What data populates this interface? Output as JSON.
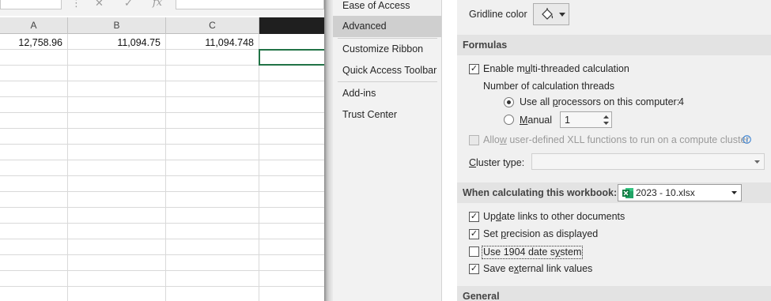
{
  "sheet": {
    "columns": [
      "A",
      "B",
      "C",
      ""
    ],
    "row1_values": [
      "12,758.96",
      "11,094.75",
      "11,094.748",
      ""
    ],
    "formula_icons": [
      "cancel-icon",
      "confirm-icon",
      "insert-function-icon"
    ],
    "formula_glyphs": {
      "more": "⋮",
      "cancel": "✕",
      "confirm": "✓",
      "fx": "fx"
    }
  },
  "nav": {
    "items": [
      "Ease of Access",
      "Advanced",
      "Customize Ribbon",
      "Quick Access Toolbar",
      "Add-ins",
      "Trust Center"
    ],
    "selected": "Advanced"
  },
  "options": {
    "gridline_color_label": "Gridline color",
    "formulas_header": "Formulas",
    "multithread_label": "Enable multi-threaded calculation",
    "multithread_checked": true,
    "threads_label": "Number of calculation threads",
    "all_processors_label": "Use all processors on this computer:",
    "processor_count": "4",
    "manual_label": "Manual",
    "manual_threads_value": "1",
    "xll_label": "Allow user-defined XLL functions to run on a compute cluster",
    "cluster_type_label": "Cluster type:",
    "cluster_type_value": "",
    "workbook_header": "When calculating this workbook:",
    "workbook_name": "2023 - 10.xlsx",
    "update_links_label": "Update links to other documents",
    "update_links_checked": true,
    "precision_label": "Set precision as displayed",
    "precision_checked": true,
    "date1904_label": "Use 1904 date system",
    "date1904_checked": false,
    "save_links_label": "Save external link values",
    "save_links_checked": true,
    "general_header": "General"
  },
  "icons": {
    "paint_bucket": "paint-bucket-icon",
    "excel_file": "excel-file-icon",
    "info": "info-icon",
    "checkmark": "✓"
  },
  "colors": {
    "excel_green": "#217346",
    "nav_selected": "#cfcfcf",
    "info_blue": "#2b79d0"
  }
}
